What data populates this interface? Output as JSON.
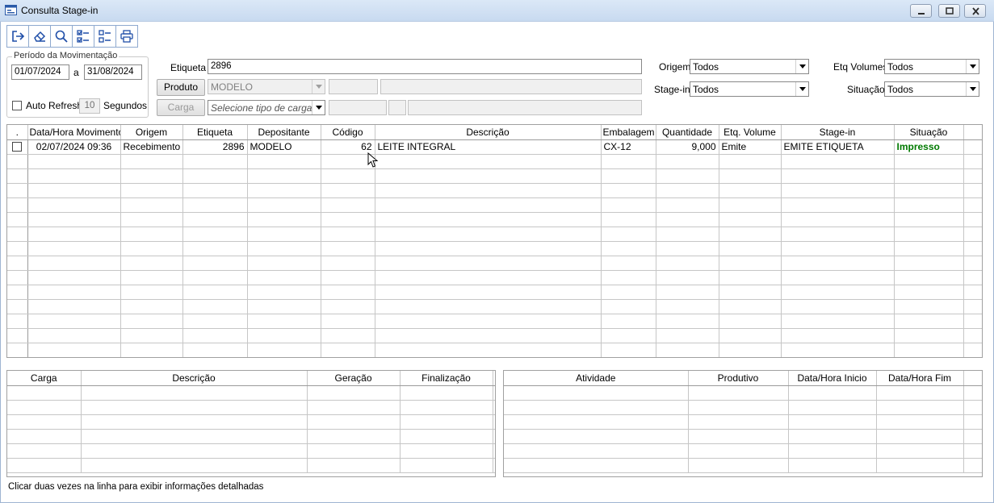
{
  "window": {
    "title": "Consulta Stage-in",
    "app_icon": "window-icon",
    "controls": [
      "minimize-icon",
      "maximize-icon",
      "close-icon"
    ]
  },
  "toolbar": {
    "buttons": [
      {
        "icon": "exit-icon"
      },
      {
        "icon": "eraser-icon"
      },
      {
        "icon": "search-icon"
      },
      {
        "icon": "checklist-icon"
      },
      {
        "icon": "list-icon"
      },
      {
        "icon": "printer-icon"
      }
    ]
  },
  "periodo": {
    "legend": "Período da Movimentação",
    "start": "01/07/2024",
    "separator": "a",
    "end": "31/08/2024",
    "auto_refresh_label": "Auto Refresh",
    "refresh_value": "10",
    "seconds_label": "Segundos"
  },
  "filters": {
    "etiqueta_label": "Etiqueta",
    "etiqueta_value": "2896",
    "produto_button": "Produto",
    "produto_value": "MODELO",
    "carga_button": "Carga",
    "carga_placeholder": "Selecione tipo de carga",
    "origem_label": "Origem",
    "origem_value": "Todos",
    "stagein_label": "Stage-in",
    "stagein_value": "Todos",
    "etq_volumes_label": "Etq Volumes",
    "etq_volumes_value": "Todos",
    "situacao_label": "Situação",
    "situacao_value": "Todos"
  },
  "main_grid": {
    "columns": [
      ".",
      "Data/Hora Movimento",
      "Origem",
      "Etiqueta",
      "Depositante",
      "Código",
      "Descrição",
      "Embalagem",
      "Quantidade",
      "Etq. Volume",
      "Stage-in",
      "Situação"
    ],
    "rows": [
      {
        "data_hora": "02/07/2024 09:36",
        "origem": "Recebimento",
        "etiqueta": "2896",
        "depositante": "MODELO",
        "codigo": "62",
        "descricao": "LEITE INTEGRAL",
        "embalagem": "CX-12",
        "quantidade": "9,000",
        "etq_volume": "Emite",
        "stage_in": "EMITE ETIQUETA",
        "situacao": "Impresso"
      }
    ]
  },
  "carga_grid": {
    "columns": [
      "Carga",
      "Descrição",
      "Geração",
      "Finalização"
    ]
  },
  "atividade_grid": {
    "columns": [
      "Atividade",
      "Produtivo",
      "Data/Hora Inicio",
      "Data/Hora Fim"
    ]
  },
  "status_bar": {
    "text": "Clicar duas vezes na linha para exibir informações detalhadas"
  },
  "colors": {
    "title_bar": "#c8daf0",
    "impresso": "#007a00",
    "toolbar_icon": "#1f4ea8"
  }
}
